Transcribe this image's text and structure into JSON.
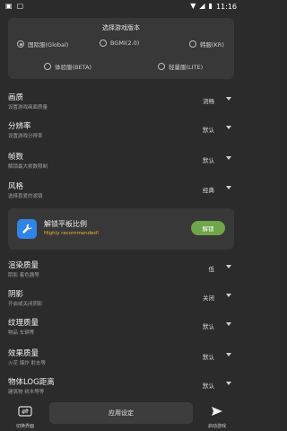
{
  "status_bar": {
    "time": "11:16"
  },
  "version": {
    "title": "选择游戏版本",
    "options": [
      {
        "label": "国际服(Global)",
        "selected": true
      },
      {
        "label": "BGMI(2.0)",
        "selected": false
      },
      {
        "label": "韩服(KR)",
        "selected": false
      },
      {
        "label": "体验服(BETA)",
        "selected": false
      },
      {
        "label": "轻量服(LITE)",
        "selected": false
      }
    ]
  },
  "settings": [
    {
      "title": "画质",
      "desc": "设置游戏画面质量",
      "value": "流畅"
    },
    {
      "title": "分辨率",
      "desc": "设置游戏分辨率",
      "value": "默认"
    },
    {
      "title": "帧数",
      "desc": "解锁最大帧数限制",
      "value": "默认"
    },
    {
      "title": "风格",
      "desc": "选择喜爱的滤镜",
      "value": "经典"
    }
  ],
  "promo": {
    "title": "解锁平板比例",
    "subtitle": "Highly recommended!",
    "button": "解锁"
  },
  "settings2": [
    {
      "title": "渲染质量",
      "desc": "阴影 着色器等",
      "value": "低"
    },
    {
      "title": "阴影",
      "desc": "开启或关闭阴影",
      "value": "关闭"
    },
    {
      "title": "纹理质量",
      "desc": "物品 车辆等",
      "value": "默认"
    },
    {
      "title": "效果质量",
      "desc": "火花 爆炸 射击等",
      "value": "默认"
    },
    {
      "title": "物体LOG距离",
      "desc": "建筑物 树木等等",
      "value": "默认"
    }
  ],
  "bottom": {
    "left_label": "切换界面",
    "apply": "应用设定",
    "right_label": "启动游戏"
  }
}
